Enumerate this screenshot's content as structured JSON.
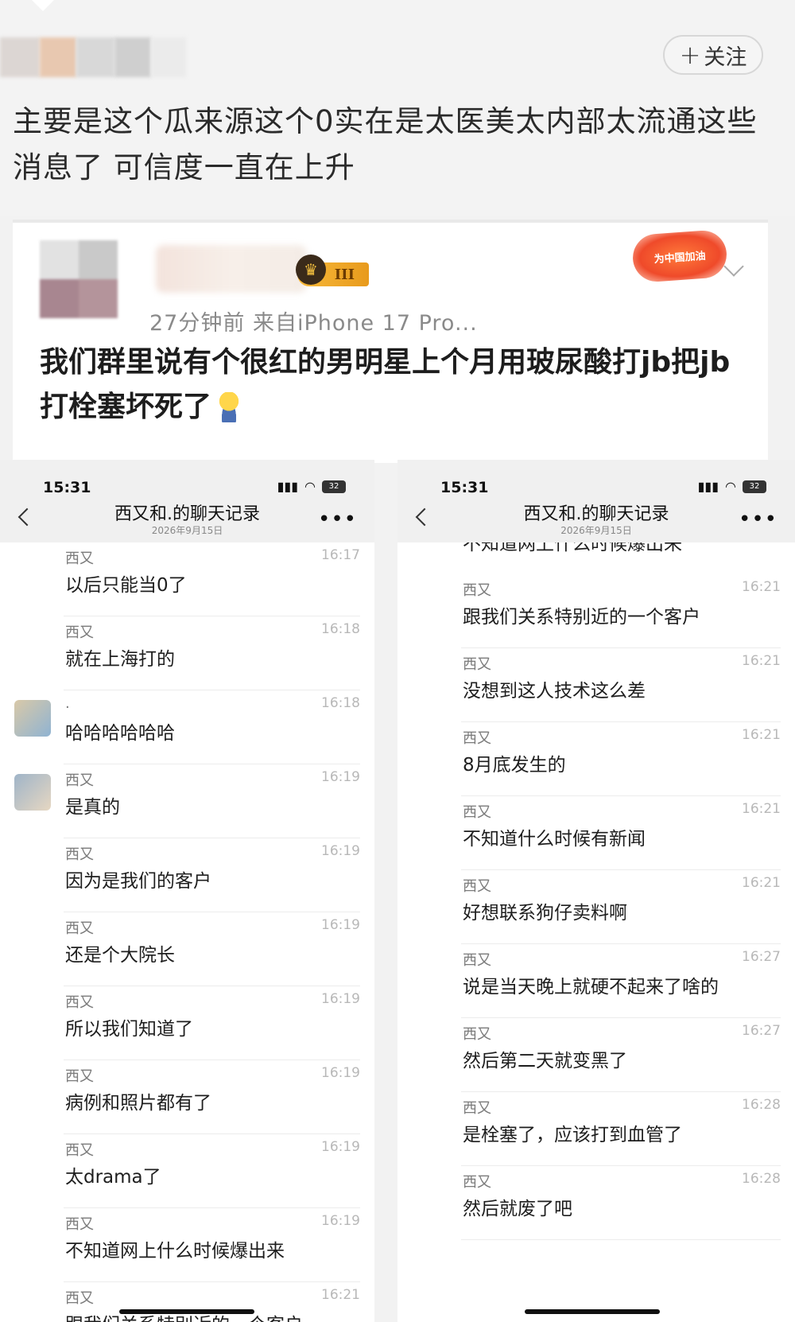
{
  "post": {
    "follow_plus": "+",
    "follow_label": "关注",
    "text": "主要是这个瓜来源这个0实在是太医美太内部太流通这些消息了 可信度一直在上升"
  },
  "repost": {
    "vip_level": "III",
    "meta": "27分钟前  来自iPhone 17 Pro...",
    "promo_badge": "为中国加油",
    "text": "我们群里说有个很红的男明星上个月用玻尿酸打jb把jb打栓塞坏死了"
  },
  "left_chat": {
    "status_time": "15:31",
    "battery": "32",
    "title": "西又和.的聊天记录",
    "date": "2026年9月15日",
    "more": "•••",
    "messages": [
      {
        "sender": "西又",
        "time": "16:17",
        "text": "以后只能当0了"
      },
      {
        "sender": "西又",
        "time": "16:18",
        "text": "就在上海打的"
      },
      {
        "sender": ".",
        "time": "16:18",
        "text": "哈哈哈哈哈哈"
      },
      {
        "sender": "西又",
        "time": "16:19",
        "text": "是真的"
      },
      {
        "sender": "西又",
        "time": "16:19",
        "text": "因为是我们的客户"
      },
      {
        "sender": "西又",
        "time": "16:19",
        "text": "还是个大院长"
      },
      {
        "sender": "西又",
        "time": "16:19",
        "text": "所以我们知道了"
      },
      {
        "sender": "西又",
        "time": "16:19",
        "text": "病例和照片都有了"
      },
      {
        "sender": "西又",
        "time": "16:19",
        "text": "太drama了"
      },
      {
        "sender": "西又",
        "time": "16:19",
        "text": "不知道网上什么时候爆出来"
      },
      {
        "sender": "西又",
        "time": "16:21",
        "text": "跟我们关系特别近的一个客户"
      }
    ]
  },
  "right_chat": {
    "status_time": "15:31",
    "battery": "32",
    "title": "西又和.的聊天记录",
    "date": "2026年9月15日",
    "more": "•••",
    "cut_text": "不知道网上什么时候爆出来",
    "messages": [
      {
        "sender": "西又",
        "time": "16:21",
        "text": "跟我们关系特别近的一个客户"
      },
      {
        "sender": "西又",
        "time": "16:21",
        "text": "没想到这人技术这么差"
      },
      {
        "sender": "西又",
        "time": "16:21",
        "text": "8月底发生的"
      },
      {
        "sender": "西又",
        "time": "16:21",
        "text": "不知道什么时候有新闻"
      },
      {
        "sender": "西又",
        "time": "16:21",
        "text": "好想联系狗仔卖料啊"
      },
      {
        "sender": "西又",
        "time": "16:27",
        "text": "说是当天晚上就硬不起来了啥的"
      },
      {
        "sender": "西又",
        "time": "16:27",
        "text": "然后第二天就变黑了"
      },
      {
        "sender": "西又",
        "time": "16:28",
        "text": "是栓塞了，应该打到血管了"
      },
      {
        "sender": "西又",
        "time": "16:28",
        "text": "然后就废了吧"
      }
    ]
  }
}
